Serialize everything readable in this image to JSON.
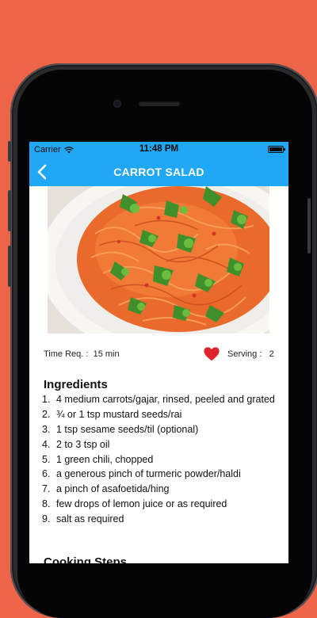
{
  "status_bar": {
    "carrier": "Carrier",
    "time": "11:48 PM"
  },
  "nav": {
    "title": "CARROT SALAD",
    "back_icon": "chevron-left-icon"
  },
  "recipe": {
    "time_label": "Time Req. :",
    "time_value": "15 min",
    "serving_label": "Serving :",
    "serving_value": "2",
    "favorite_icon": "heart-icon",
    "favorite_color": "#e0242b"
  },
  "ingredients": {
    "title": "Ingredients",
    "items": [
      {
        "num": "1.",
        "text": "4 medium carrots/gajar, rinsed, peeled and grated"
      },
      {
        "num": "2.",
        "text": "¾ or 1 tsp mustard seeds/rai"
      },
      {
        "num": "3.",
        "text": "1 tsp sesame seeds/til (optional)"
      },
      {
        "num": "4.",
        "text": "2 to 3 tsp oil"
      },
      {
        "num": "5.",
        "text": "1 green chili, chopped"
      },
      {
        "num": "6.",
        "text": "a generous pinch of turmeric powder/haldi"
      },
      {
        "num": "7.",
        "text": "a pinch of asafoetida/hing"
      },
      {
        "num": "8.",
        "text": "few drops of lemon juice or as required"
      },
      {
        "num": "9.",
        "text": "salt as required"
      }
    ]
  },
  "cooking": {
    "title": "Cooking Steps"
  },
  "colors": {
    "background": "#ee6448",
    "nav_bar": "#21a8f4"
  }
}
